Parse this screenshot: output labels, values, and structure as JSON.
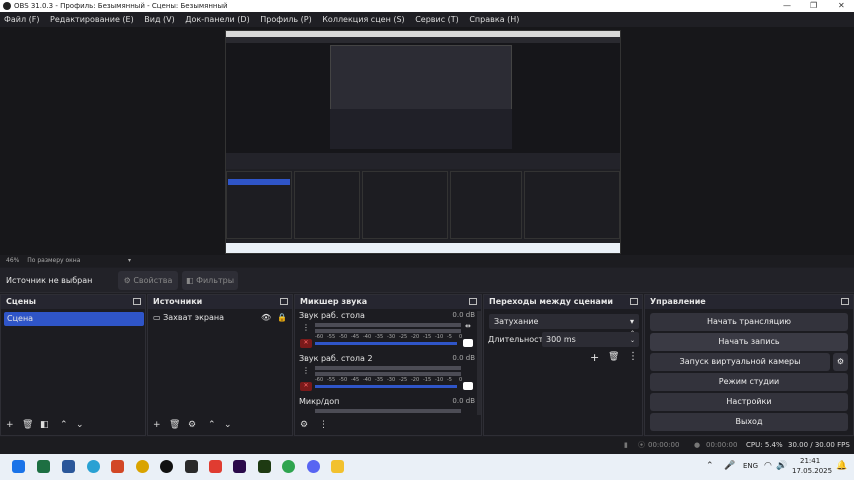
{
  "titlebar": {
    "title": "OBS 31.0.3 - Профиль: Безымянный - Сцены: Безымянный"
  },
  "menu": [
    "Файл (F)",
    "Редактирование (E)",
    "Вид (V)",
    "Док-панели (D)",
    "Профиль (P)",
    "Коллекция сцен (S)",
    "Сервис (T)",
    "Справка (H)"
  ],
  "zoom": {
    "percent": "46%",
    "mode": "По размеру окна"
  },
  "source_bar": {
    "status": "Источник не выбран",
    "properties": "Свойства",
    "filters": "Фильтры"
  },
  "scenes": {
    "title": "Сцены",
    "items": [
      "Сцена"
    ]
  },
  "sources": {
    "title": "Источники",
    "items": [
      "Захват экрана"
    ]
  },
  "mixer": {
    "title": "Микшер звука",
    "ticks": [
      "-60",
      "-55",
      "-50",
      "-45",
      "-40",
      "-35",
      "-30",
      "-25",
      "-20",
      "-15",
      "-10",
      "-5",
      "0"
    ],
    "channels": [
      {
        "name": "Звук раб. стола",
        "db": "0.0 dB"
      },
      {
        "name": "Звук раб. стола 2",
        "db": "0.0 dB"
      },
      {
        "name": "Микр/доп",
        "db": "0.0 dB"
      }
    ]
  },
  "transitions": {
    "title": "Переходы между сценами",
    "type": "Затухание",
    "duration_label": "Длительность",
    "duration": "300 ms"
  },
  "controls": {
    "title": "Управление",
    "buttons": [
      "Начать трансляцию",
      "Начать запись",
      "Запуск виртуальной камеры",
      "Режим студии",
      "Настройки",
      "Выход"
    ]
  },
  "status": {
    "stream_time": "00:00:00",
    "rec_time": "00:00:00",
    "cpu": "CPU: 5.4%",
    "fps": "30.00 / 30.00 FPS"
  },
  "taskbar": {
    "lang": "ENG",
    "time": "21:41",
    "date": "17.05.2025"
  }
}
